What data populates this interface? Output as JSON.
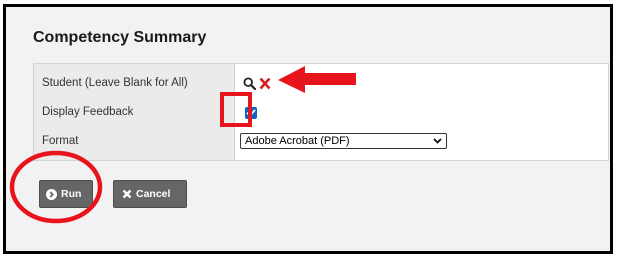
{
  "panel": {
    "title": "Competency Summary"
  },
  "form": {
    "rows": [
      {
        "label": "Student (Leave Blank for All)"
      },
      {
        "label": "Display Feedback",
        "checked": true
      },
      {
        "label": "Format"
      }
    ],
    "format_select": {
      "selected": "Adobe Acrobat (PDF)"
    }
  },
  "buttons": {
    "run": {
      "label": "Run",
      "icon": "chevron-right-circle-icon"
    },
    "cancel": {
      "label": "Cancel",
      "icon": "x-icon"
    }
  },
  "icons": {
    "student_search": "search-icon",
    "student_clear": "close-icon"
  },
  "colors": {
    "annotation": "#e8141c",
    "checkbox": "#0b63ce",
    "button": "#666666",
    "clear_x": "#d81e1e"
  }
}
